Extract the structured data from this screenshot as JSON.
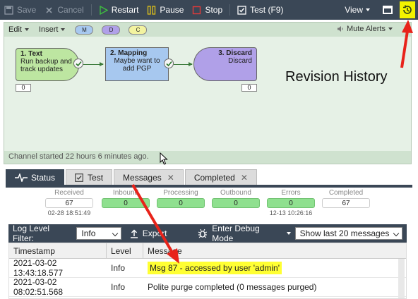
{
  "toolbar": {
    "save_label": "Save",
    "cancel_label": "Cancel",
    "restart_label": "Restart",
    "pause_label": "Pause",
    "stop_label": "Stop",
    "test_label": "Test (F9)",
    "view_label": "View"
  },
  "canvas_bar": {
    "edit_label": "Edit",
    "insert_label": "Insert",
    "pills": [
      "M",
      "D",
      "C"
    ],
    "mute_label": "Mute Alerts"
  },
  "nodes": [
    {
      "title": "1. Text",
      "desc": "Run backup and track updates",
      "count": "0",
      "color": "#bde6a1"
    },
    {
      "title": "2. Mapping",
      "desc": "Maybe want to add PGP",
      "count": "",
      "color": "#a7c8ef"
    },
    {
      "title": "3. Discard",
      "desc": "Discard",
      "count": "0",
      "color": "#b0a0e8"
    }
  ],
  "canvas_status": "Channel started 22 hours 6 minutes ago.",
  "annotation": "Revision History",
  "tabs": [
    {
      "label": "Status",
      "active": true
    },
    {
      "label": "Test",
      "active": false
    },
    {
      "label": "Messages",
      "active": false
    },
    {
      "label": "Completed",
      "active": false
    }
  ],
  "stats": [
    {
      "label": "Received",
      "value": "67",
      "time": "02-28 18:51:49",
      "style": "plain"
    },
    {
      "label": "Inbound",
      "value": "0",
      "time": "",
      "style": "green"
    },
    {
      "label": "Processing",
      "value": "0",
      "time": "",
      "style": "green"
    },
    {
      "label": "Outbound",
      "value": "0",
      "time": "",
      "style": "green"
    },
    {
      "label": "Errors",
      "value": "0",
      "time": "12-13 10:26:16",
      "style": "green"
    },
    {
      "label": "Completed",
      "value": "67",
      "time": "",
      "style": "plain"
    }
  ],
  "logbar": {
    "filter_label": "Log Level Filter:",
    "filter_value": "Info",
    "export_label": "Export",
    "debug_label": "Enter Debug Mode",
    "show_value": "Show last 20 messages"
  },
  "log": {
    "headers": [
      "Timestamp",
      "Level",
      "Message"
    ],
    "rows": [
      {
        "timestamp": "2021-03-02 13:43:18.577",
        "level": "Info",
        "message": "Msg 87 - accessed by user 'admin'"
      },
      {
        "timestamp": "2021-03-02 08:02:51.568",
        "level": "Info",
        "message": "Polite purge completed (0 messages purged)"
      }
    ]
  },
  "colors": {
    "toolbar_bg": "#3a4756",
    "canvas_bg": "#e6f1e6",
    "highlight": "#ffff33",
    "annotation_arrow": "#e8231a"
  }
}
